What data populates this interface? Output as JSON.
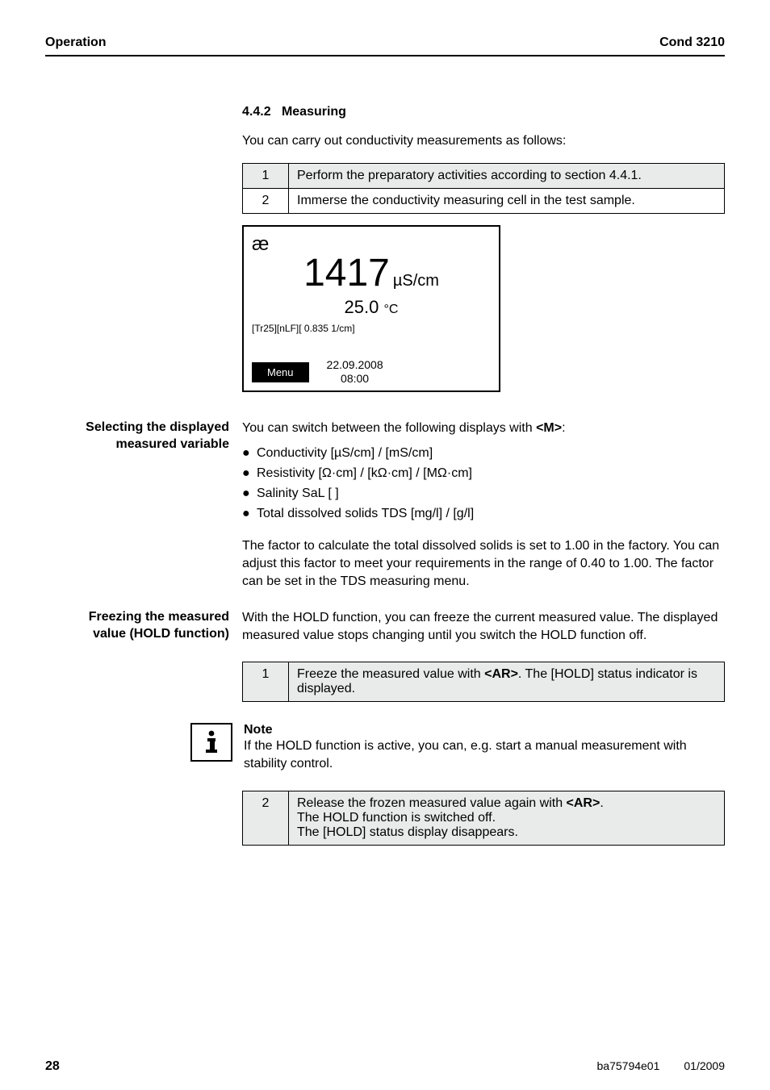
{
  "header": {
    "left": "Operation",
    "right": "Cond 3210"
  },
  "section": {
    "number": "4.4.2",
    "title": "Measuring",
    "intro": "You can carry out conductivity measurements as follows:"
  },
  "steps_top": [
    {
      "n": "1",
      "text": "Perform the preparatory activities according to section 4.4.1."
    },
    {
      "n": "2",
      "text": "Immerse the conductivity measuring cell in the test sample."
    }
  ],
  "device": {
    "symbol": "æ",
    "value": "1417",
    "unit": "µS/cm",
    "temp_value": "25.0",
    "temp_unit": "°C",
    "status": "[Tr25][nLF][ 0.835 1/cm]",
    "menu_label": "Menu",
    "date": "22.09.2008",
    "time": "08:00"
  },
  "selecting": {
    "margin_label": "Selecting the displayed measured variable",
    "lead_pre": "You can switch between the following displays with ",
    "lead_key": "<M>",
    "lead_post": ":",
    "bullets": [
      "Conductivity [µS/cm] / [mS/cm]",
      "Resistivity [Ω·cm] / [kΩ·cm] / [MΩ·cm]",
      "Salinity SaL [ ]",
      "Total dissolved solids TDS [mg/l] / [g/l]"
    ],
    "factor_note": "The factor to calculate the total dissolved solids is set to 1.00 in the factory. You can adjust this factor to meet your requirements in the range of 0.40 to 1.00. The factor can be set in the TDS measuring menu."
  },
  "freezing": {
    "margin_label": "Freezing the measured value (HOLD function)",
    "body": "With the HOLD function, you can freeze the current measured value. The displayed measured value stops changing until you switch the HOLD function off."
  },
  "step_freeze": {
    "n": "1",
    "pre": "Freeze the measured value with ",
    "key": "<AR>",
    "post": ". The [HOLD] status indicator is displayed."
  },
  "note": {
    "heading": "Note",
    "body": "If the HOLD function is active, you can, e.g. start a manual measurement with stability control."
  },
  "step_release": {
    "n": "2",
    "pre": "Release the frozen measured value again with ",
    "key": "<AR>",
    "post1": ".",
    "line2": "The HOLD function is switched off.",
    "line3": "The [HOLD] status display disappears."
  },
  "footer": {
    "page": "28",
    "id": "ba75794e01",
    "date": "01/2009"
  }
}
